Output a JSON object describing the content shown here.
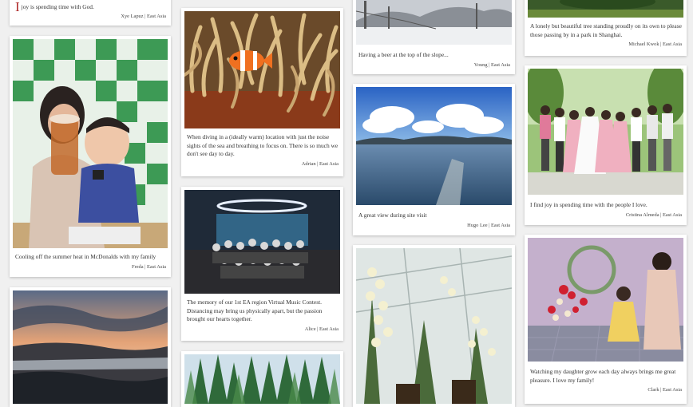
{
  "posts": [
    {
      "dropcap": "I",
      "caption": "joy is spending time with God.",
      "author": "Xye Lapuz",
      "region": "East Asia",
      "photo_alt": ""
    },
    {
      "caption": "Cooling off the summer heat in McDonalds with my family",
      "author": "Freda",
      "region": "East Asia",
      "photo_alt": "mother and baby with drink"
    },
    {
      "caption": "",
      "author": "",
      "region": "",
      "photo_alt": "sunset over sea"
    },
    {
      "caption": "When diving in a (ideally warm) location with just the noise sights of the sea and breathing to focus on. There is so much we don't see day to day.",
      "author": "Adrian",
      "region": "East Asia",
      "photo_alt": "clownfish in anemone"
    },
    {
      "caption": "The memory of our 1st EA region Virtual Music Contest. Distancing may bring us physically apart, but the passion brought our hearts together.",
      "author": "Alice",
      "region": "East Asia",
      "photo_alt": "group photo on stage"
    },
    {
      "caption": "",
      "author": "",
      "region": "",
      "photo_alt": "forest"
    },
    {
      "caption": "Having a beer at the top of the slope...",
      "author": "Young",
      "region": "East Asia",
      "photo_alt": "snowy slope"
    },
    {
      "caption": "A great view during site visit",
      "author": "Hugo Lee",
      "region": "East Asia",
      "photo_alt": "lake and clouds"
    },
    {
      "caption": "",
      "author": "",
      "region": "",
      "photo_alt": "orchids in greenhouse"
    },
    {
      "caption": "A lonely but beautiful tree standing proudly on its own to please those passing by in a park in Shanghai.",
      "author": "Michael Kwok",
      "region": "East Asia",
      "photo_alt": "tree in park"
    },
    {
      "caption": "I find joy in spending time with the people I love.",
      "author": "Cristina Almeda",
      "region": "East Asia",
      "photo_alt": "wedding group"
    },
    {
      "caption": "Watching my daughter grow each day always brings me great pleasure. I love my family!",
      "author": "Clark",
      "region": "East Asia",
      "photo_alt": "mother and daughter with flowers"
    }
  ],
  "separator": " | "
}
